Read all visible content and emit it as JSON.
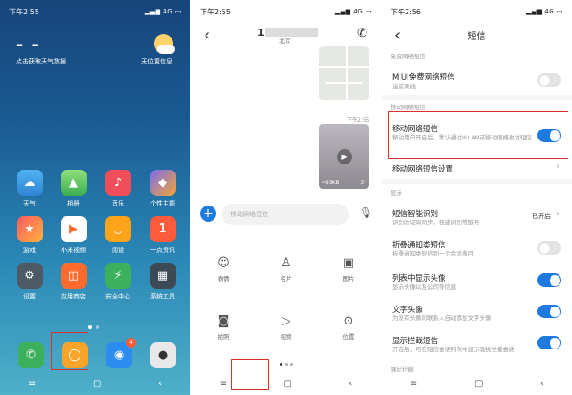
{
  "colors": {
    "accent": "#1f7ae0",
    "highlight": "#d9342b"
  },
  "home": {
    "status_time": "下午2:55",
    "status_net": "4G",
    "weather_dash": "– –",
    "weather_tip": "点击获取天气数据",
    "weather_loc": "无位置信息",
    "apps": [
      {
        "label": "天气",
        "icon": "weather-icon",
        "color": "#3fa0e0"
      },
      {
        "label": "相册",
        "icon": "gallery-icon",
        "color": "#56c06a"
      },
      {
        "label": "音乐",
        "icon": "music-icon",
        "color": "#f04e5a"
      },
      {
        "label": "个性主题",
        "icon": "theme-icon",
        "color": "#f3a534"
      },
      {
        "label": "游戏",
        "icon": "game-icon",
        "color": "#ff7043"
      },
      {
        "label": "小米视频",
        "icon": "video-icon",
        "color": "#ffffff"
      },
      {
        "label": "阅读",
        "icon": "reading-icon",
        "color": "#ffa31a"
      },
      {
        "label": "一点资讯",
        "icon": "news-icon",
        "color": "#ff5a3c"
      },
      {
        "label": "设置",
        "icon": "settings-icon",
        "color": "#4d5a66"
      },
      {
        "label": "应用商店",
        "icon": "app-store-icon",
        "color": "#ff6a2d"
      },
      {
        "label": "安全中心",
        "icon": "security-icon",
        "color": "#3cb05a"
      },
      {
        "label": "系统工具",
        "icon": "system-tools-icon",
        "color": "#3c4a55"
      }
    ],
    "dock_badge": "4"
  },
  "chat": {
    "status_time": "下午2:55",
    "status_net": "4G",
    "title_prefix": "1",
    "location_sub": "北京",
    "msg_time": "下午2:55",
    "video_size": "493KB",
    "video_duration": "3\"",
    "input_placeholder": "移动网络短信",
    "attachments": [
      {
        "label": "表情",
        "icon": "emoji-icon"
      },
      {
        "label": "名片",
        "icon": "contact-card-icon"
      },
      {
        "label": "图片",
        "icon": "image-icon"
      },
      {
        "label": "拍照",
        "icon": "camera-icon"
      },
      {
        "label": "视频",
        "icon": "video-icon"
      },
      {
        "label": "位置",
        "icon": "location-icon"
      }
    ]
  },
  "settings": {
    "status_time": "下午2:56",
    "status_net": "4G",
    "title": "短信",
    "sec_free": "免费网络短信",
    "miui_title": "MIUI免费网络短信",
    "miui_sub": "当前离线",
    "miui_on": false,
    "sec_mobile": "移动网络短信",
    "mobile_title": "移动网络短信",
    "mobile_sub": "移动用户开启后，默认通过WLAN或移动网络收发短信",
    "mobile_on": true,
    "mobile_settings": "移动网络短信设置",
    "sec_display": "显示",
    "smart_title": "短信智能识别",
    "smart_sub": "识别验证码同步，快速识别等服务",
    "smart_value": "已开启",
    "fold_title": "折叠通知类短信",
    "fold_sub": "折叠通知类短信到一个会话条目",
    "fold_on": false,
    "avatar_title": "列表中显示头像",
    "avatar_sub": "显示头像以及公司等信息",
    "avatar_on": true,
    "text_avatar_title": "文字头像",
    "text_avatar_sub": "为没有头像的联系人自动添加文字头像",
    "text_avatar_on": true,
    "block_title": "显示拦截短信",
    "block_sub": "开启后，可在短信会话列表中显示骚扰拦截会话",
    "block_on": true,
    "sec_bottom": "骚扰拦截"
  },
  "nav": {
    "menu": "≡",
    "home": "▢",
    "back": "‹"
  }
}
